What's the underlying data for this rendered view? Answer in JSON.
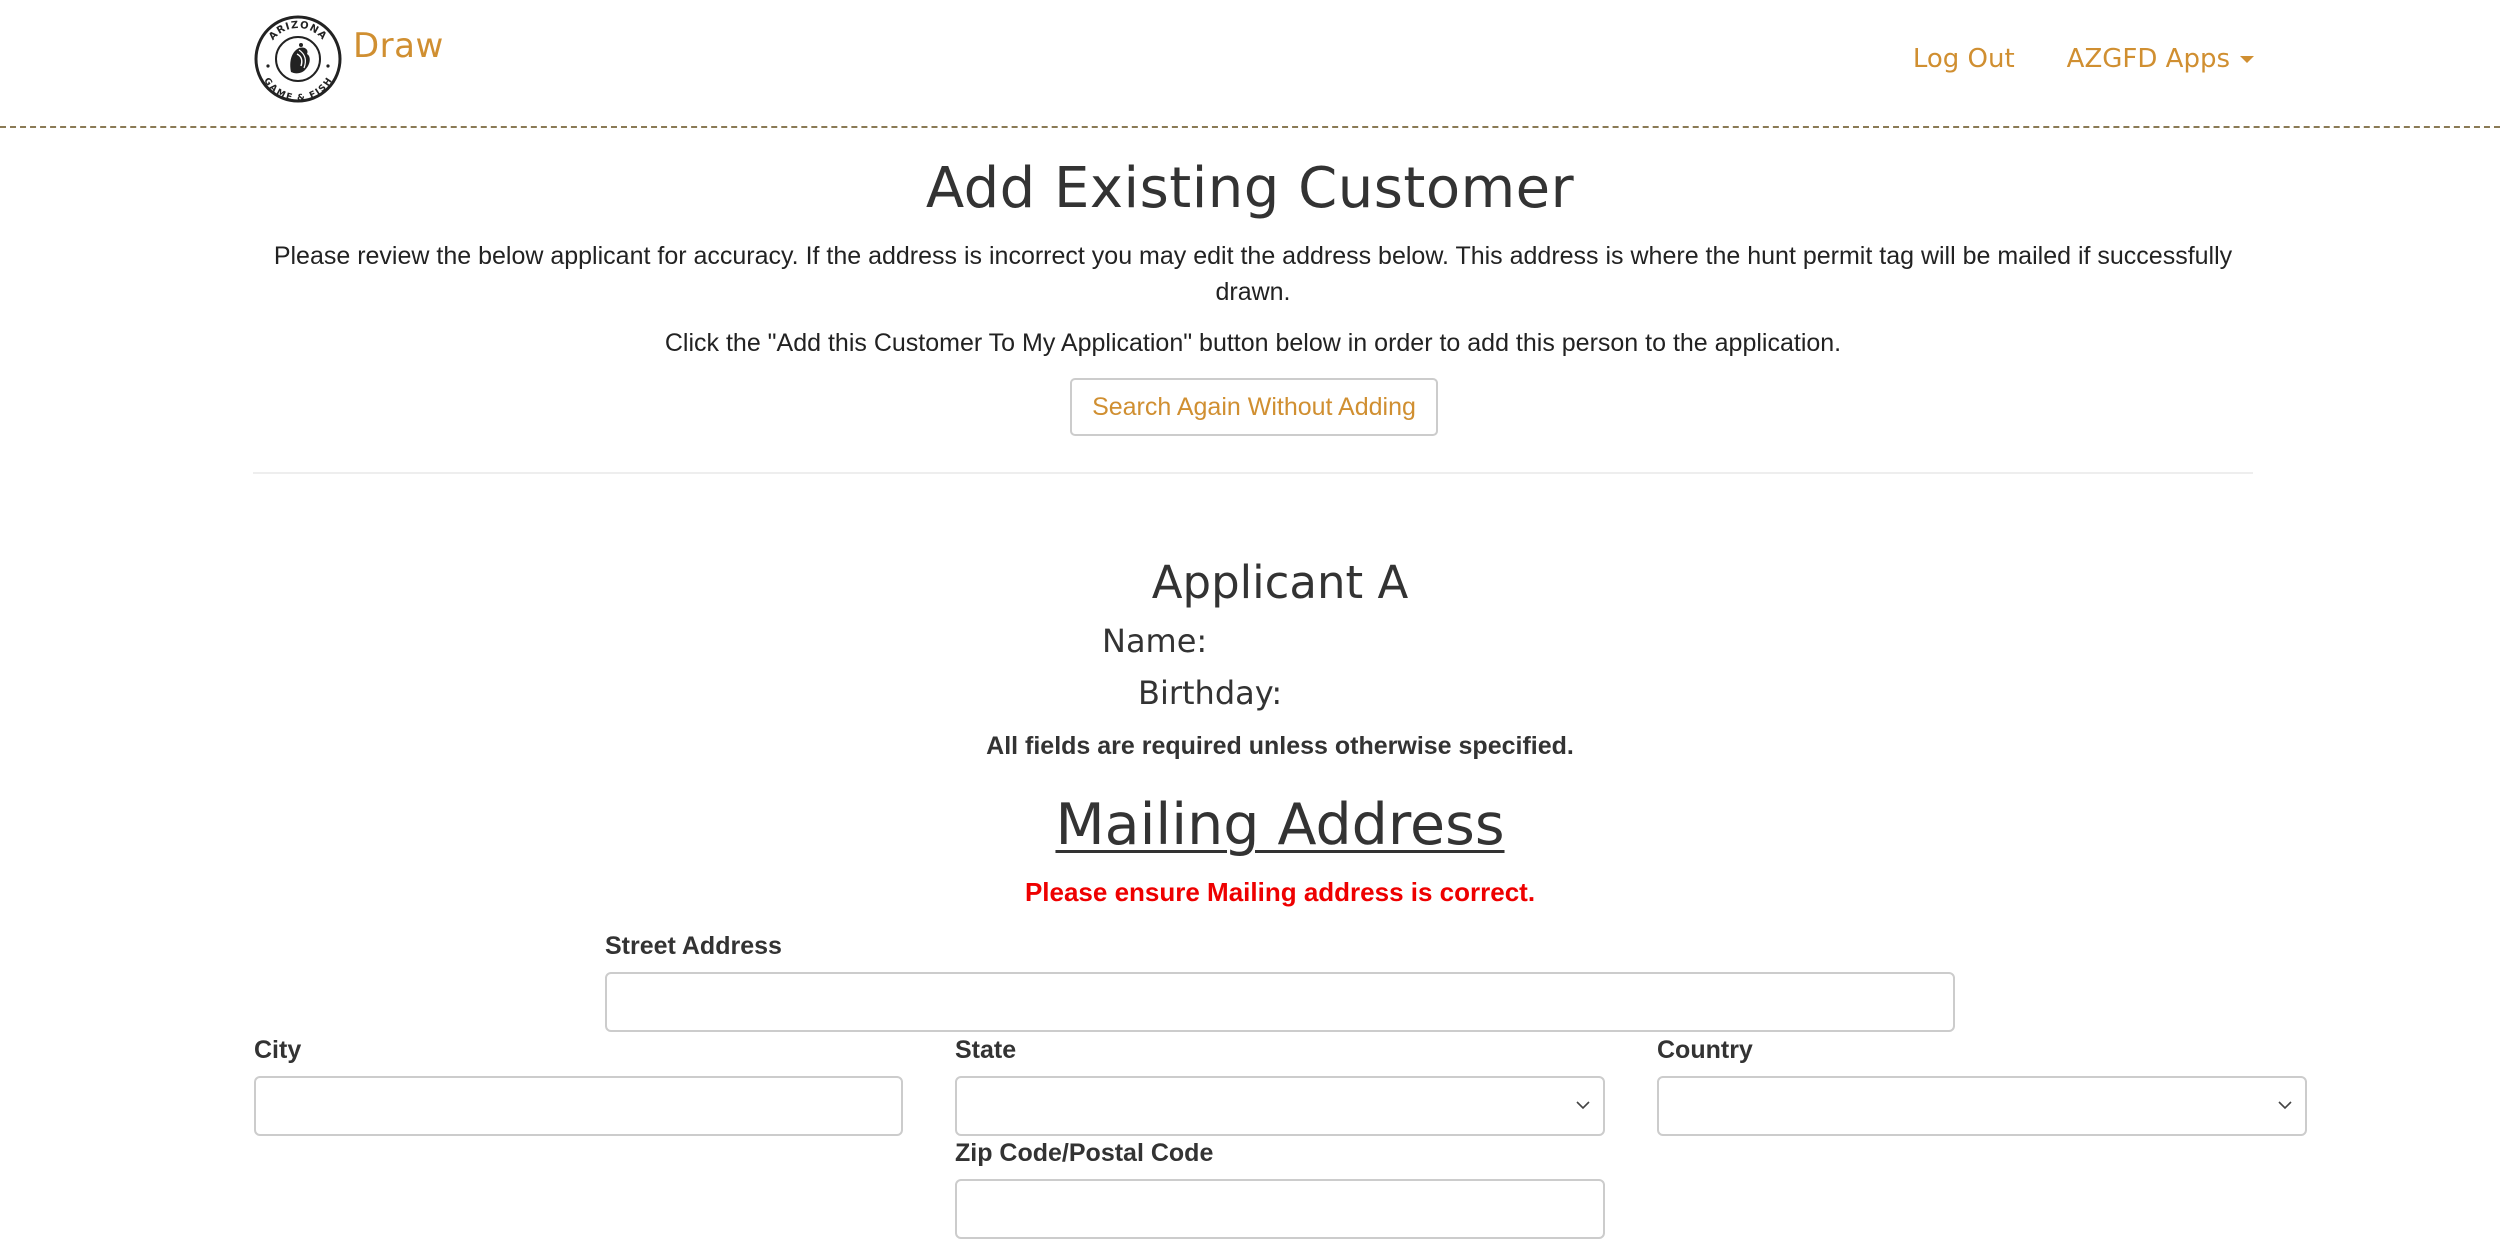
{
  "header": {
    "logo_alt": "Arizona Game & Fish",
    "logo_ring_top": "ARIZONA",
    "logo_ring_bottom": "GAME & FISH",
    "brand": "Draw",
    "nav": {
      "logout": "Log Out",
      "apps": "AZGFD Apps"
    }
  },
  "page": {
    "title": "Add Existing Customer",
    "intro": "Please review the below applicant for accuracy. If the address is incorrect you may edit the address below. This address is where the hunt permit tag will be mailed if successfully drawn.",
    "instruction": "Click the \"Add this Customer To My Application\" button below in order to add this person to the application.",
    "search_again_button": "Search Again Without Adding"
  },
  "applicant": {
    "title": "Applicant A",
    "name_label": "Name:",
    "name_value": "",
    "birthday_label": "Birthday:",
    "birthday_value": ""
  },
  "form": {
    "required_note": "All fields are required unless otherwise specified.",
    "section_title": "Mailing Address",
    "warning": "Please ensure Mailing address is correct.",
    "warning_color": "#ee0000",
    "fields": {
      "street": {
        "label": "Street Address",
        "value": ""
      },
      "city": {
        "label": "City",
        "value": ""
      },
      "state": {
        "label": "State",
        "value": ""
      },
      "country": {
        "label": "Country",
        "value": ""
      },
      "zip": {
        "label": "Zip Code/Postal Code",
        "value": ""
      }
    }
  },
  "colors": {
    "accent": "#d08f31",
    "text": "#333333",
    "border": "#cccccc"
  }
}
